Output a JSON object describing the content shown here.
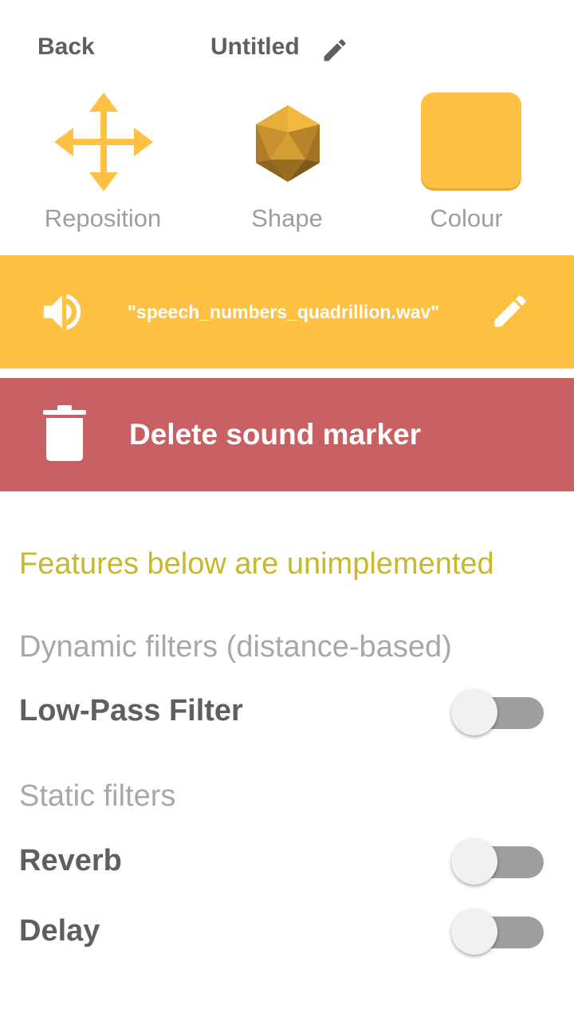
{
  "header": {
    "back_label": "Back",
    "title": "Untitled"
  },
  "tools": {
    "reposition_label": "Reposition",
    "shape_label": "Shape",
    "colour_label": "Colour"
  },
  "sound": {
    "file_label": "\"speech_numbers_quadrillion.wav\""
  },
  "delete": {
    "label": "Delete sound marker"
  },
  "notice": {
    "unimplemented": "Features below are unimplemented"
  },
  "filters": {
    "dynamic_heading": "Dynamic filters (distance-based)",
    "static_heading": "Static filters",
    "low_pass": {
      "label": "Low-Pass Filter",
      "enabled": false
    },
    "reverb": {
      "label": "Reverb",
      "enabled": false
    },
    "delay": {
      "label": "Delay",
      "enabled": false
    }
  },
  "colors": {
    "accent": "#fec144",
    "danger": "#c85f62",
    "warning_text": "#c8b82a"
  }
}
